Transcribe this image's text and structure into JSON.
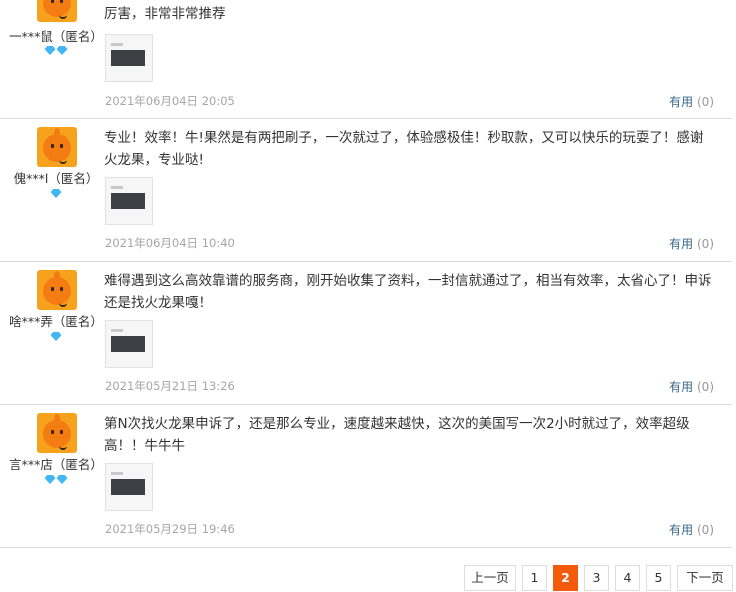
{
  "reviews": [
    {
      "username": "一***鼠（匿名）",
      "badge_count": 2,
      "content": "厉害，非常非常推荐",
      "date": "2021年06月04日 20:05",
      "useful_label": "有用",
      "useful_count": "(0)"
    },
    {
      "username": "傀***l（匿名）",
      "badge_count": 1,
      "content": "专业！效率！牛!果然是有两把刷子，一次就过了，体验感极佳！秒取款，又可以快乐的玩耍了！感谢火龙果，专业哒!",
      "date": "2021年06月04日 10:40",
      "useful_label": "有用",
      "useful_count": "(0)"
    },
    {
      "username": "啥***弄（匿名）",
      "badge_count": 1,
      "content": "难得遇到这么高效靠谱的服务商，刚开始收集了资料，一封信就通过了，相当有效率，太省心了！申诉还是找火龙果嘎！",
      "date": "2021年05月21日 13:26",
      "useful_label": "有用",
      "useful_count": "(0)"
    },
    {
      "username": "言***店（匿名）",
      "badge_count": 2,
      "content": "第N次找火龙果申诉了，还是那么专业，速度越来越快，这次的美国写一次2小时就过了，效率超级高！！牛牛牛",
      "date": "2021年05月29日 19:46",
      "useful_label": "有用",
      "useful_count": "(0)"
    }
  ],
  "pagination": {
    "prev_label": "上一页",
    "next_label": "下一页",
    "pages": [
      "1",
      "2",
      "3",
      "4",
      "5"
    ],
    "current_page": "2"
  },
  "colors": {
    "accent": "#f55a0a",
    "badge": "#41b6f2",
    "useful_link": "#3b6a8a"
  },
  "icons": {
    "avatar": "orange-mascot-avatar-icon",
    "badge": "diamond-icon",
    "thumbnail": "screenshot-thumbnail-icon"
  }
}
